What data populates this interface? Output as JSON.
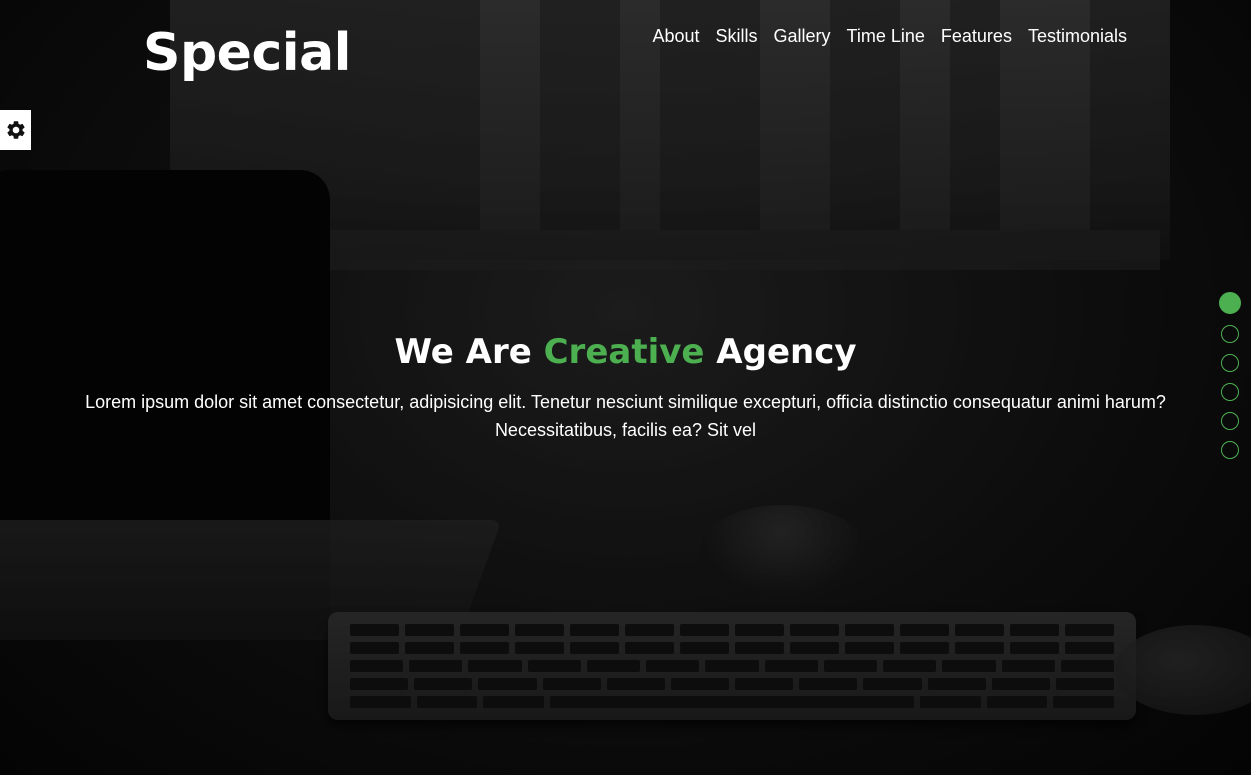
{
  "brand": {
    "logo_text": "Special"
  },
  "nav": {
    "items": [
      {
        "label": "About"
      },
      {
        "label": "Skills"
      },
      {
        "label": "Gallery"
      },
      {
        "label": "Time Line"
      },
      {
        "label": "Features"
      },
      {
        "label": "Testimonials"
      }
    ]
  },
  "settings": {
    "icon": "gear-icon"
  },
  "hero": {
    "headline_part1": "We Are ",
    "headline_accent": "Creative",
    "headline_part2": " Agency",
    "subtext": "Lorem ipsum dolor sit amet consectetur, adipisicing elit. Tenetur nesciunt similique excepturi, officia distinctio consequatur animi harum? Necessitatibus, facilis ea? Sit vel"
  },
  "section_bullets": {
    "count": 6,
    "active_index": 0
  },
  "colors": {
    "accent": "#4caf50",
    "text": "#ffffff",
    "settings_bg": "#ffffff"
  }
}
